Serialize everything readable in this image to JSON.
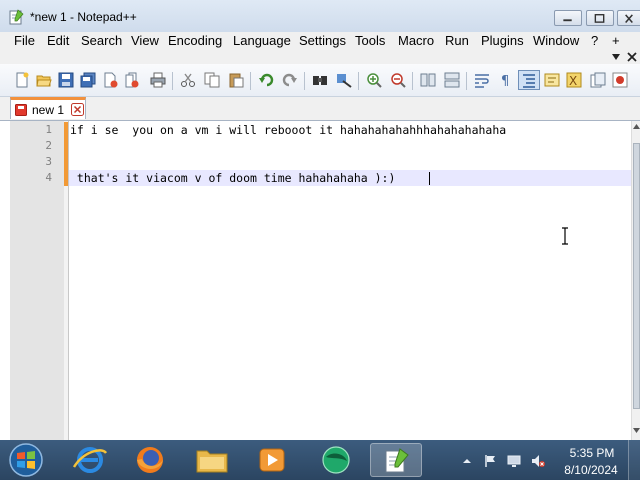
{
  "window": {
    "title": "*new 1 - Notepad++"
  },
  "menu": {
    "items": [
      "File",
      "Edit",
      "Search",
      "View",
      "Encoding",
      "Language",
      "Settings",
      "Tools",
      "Macro",
      "Run",
      "Plugins",
      "Window",
      "?",
      "+"
    ]
  },
  "tabs": [
    {
      "label": "new 1"
    }
  ],
  "editor": {
    "line_numbers": [
      "1",
      "2",
      "3",
      "4"
    ],
    "lines": [
      "if i se  you on a vm i will rebooot it hahahahahahhhahahahahaha",
      "",
      "",
      " that's it viacom v of doom time hahahahaha ):)"
    ]
  },
  "taskbar": {
    "apps": [
      "internet-explorer",
      "firefox",
      "file-explorer",
      "media-player",
      "green-app",
      "notepad-plus-plus"
    ],
    "clock_time": "5:35 PM",
    "clock_date": "8/10/2024"
  },
  "colors": {
    "tab_accent": "#f2913d",
    "modified_marker": "#f29a36",
    "taskbar": "#2f4c6c"
  }
}
